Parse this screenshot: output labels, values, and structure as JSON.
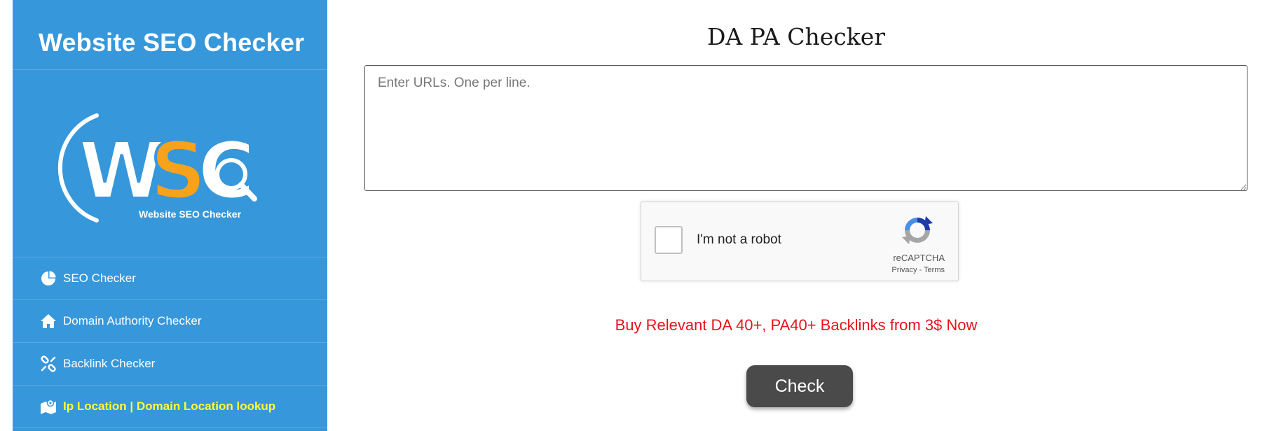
{
  "sidebar": {
    "title": "Website SEO Checker",
    "logo": {
      "letters": "WSC",
      "tagline": "Website SEO Checker"
    },
    "items": [
      {
        "label": "SEO Checker",
        "icon": "pie-chart-icon"
      },
      {
        "label": "Domain Authority Checker",
        "icon": "home-icon"
      },
      {
        "label": "Backlink Checker",
        "icon": "broken-link-icon"
      },
      {
        "label": "Ip Location | Domain Location lookup",
        "icon": "map-icon",
        "active": true
      }
    ]
  },
  "main": {
    "title": "DA PA Checker",
    "url_input": {
      "placeholder": "Enter URLs. One per line.",
      "value": ""
    },
    "captcha": {
      "label": "I'm not a robot",
      "brand": "reCAPTCHA",
      "privacy": "Privacy",
      "separator": " - ",
      "terms": "Terms"
    },
    "promo_link": "Buy Relevant DA 40+, PA40+ Backlinks from 3$ Now",
    "check_button": "Check"
  },
  "colors": {
    "sidebar_bg": "#3797db",
    "active_nav": "#ffff33",
    "promo": "#e8121c",
    "button_bg": "#4a4a4a",
    "logo_orange": "#f7a21b"
  }
}
